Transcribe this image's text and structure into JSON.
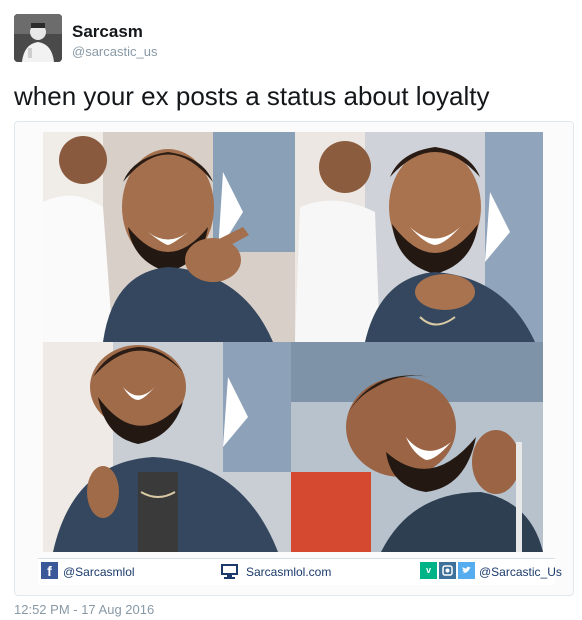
{
  "author": {
    "display_name": "Sarcasm",
    "handle": "@sarcastic_us"
  },
  "tweet": {
    "text": "when your ex posts a status about loyalty",
    "timestamp": "12:52 PM - 17 Aug 2016"
  },
  "media": {
    "panels": [
      "drake-pointing",
      "drake-grinning",
      "drake-laughing-head-back",
      "drake-laughing-hard"
    ],
    "footer": {
      "facebook_icon": "facebook-icon",
      "facebook_handle": "@Sarcasmlol",
      "website_icon": "monitor-icon",
      "website": "Sarcasmlol.com",
      "social_icons": [
        "vine-icon",
        "instagram-icon",
        "twitter-icon"
      ],
      "social_handle": "@Sarcastic_Us"
    }
  },
  "colors": {
    "name": "#14171a",
    "secondary": "#8899a6",
    "facebook": "#3b5998",
    "vine": "#00b488",
    "instagram": "#3f729b",
    "twitter": "#55acee",
    "footer_text": "#1b3a6b"
  }
}
